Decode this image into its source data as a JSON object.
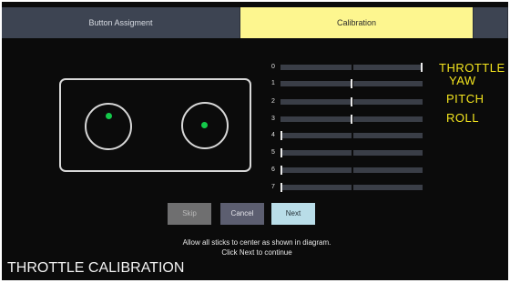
{
  "tabs": [
    {
      "label": "Button Assigment"
    },
    {
      "label": "Calibration",
      "active": true
    },
    {
      "label": ""
    }
  ],
  "channels": [
    {
      "number": "0",
      "value": 1.0
    },
    {
      "number": "1",
      "value": 0.5
    },
    {
      "number": "2",
      "value": 0.5
    },
    {
      "number": "3",
      "value": 0.5
    },
    {
      "number": "4",
      "value": 0.0
    },
    {
      "number": "5",
      "value": 0.0
    },
    {
      "number": "6",
      "value": 0.0
    },
    {
      "number": "7",
      "value": 0.0
    }
  ],
  "axis_labels": {
    "throttle": "THROTTLE",
    "yaw": "YAW",
    "pitch": "PITCH",
    "roll": "ROLL"
  },
  "buttons": {
    "skip": "Skip",
    "cancel": "Cancel",
    "next": "Next"
  },
  "instructions": {
    "line1": "Allow all sticks to center as shown in diagram.",
    "line2": "Click Next to continue"
  },
  "caption": "THROTTLE CALIBRATION",
  "colors": {
    "active_tab": "#fdf68f",
    "axis_label": "#f4e51e",
    "stick_dot": "#14c94a",
    "next_button": "#b9dde8"
  }
}
